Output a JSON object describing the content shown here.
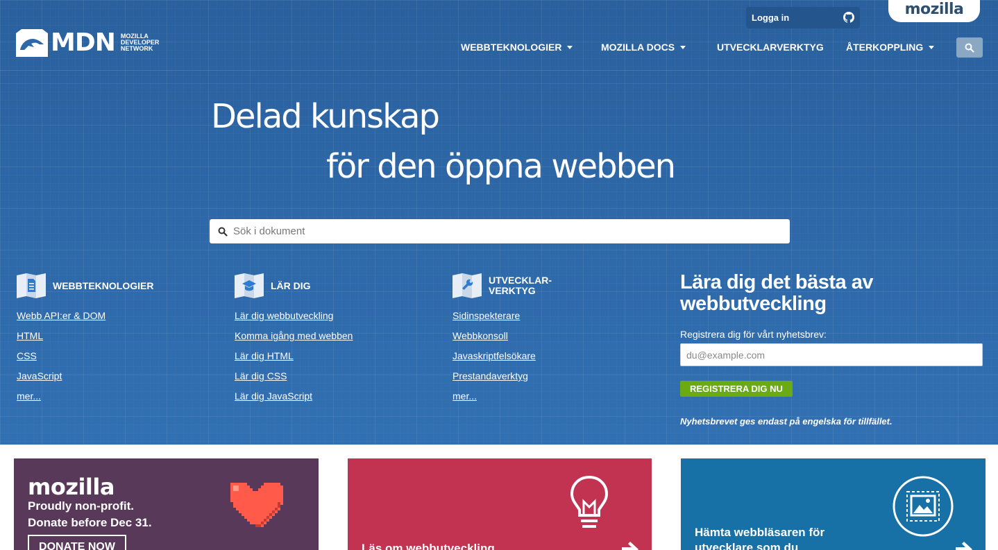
{
  "header": {
    "login_label": "Logga in",
    "mozilla_tab": "mozilla",
    "logo_text": "MDN",
    "logo_sub": [
      "MOZILLA",
      "DEVELOPER",
      "NETWORK"
    ],
    "nav": [
      {
        "label": "WEBBTEKNOLOGIER",
        "has_dropdown": true
      },
      {
        "label": "MOZILLA DOCS",
        "has_dropdown": true
      },
      {
        "label": "UTVECKLARVERKTYG",
        "has_dropdown": false
      },
      {
        "label": "ÅTERKOPPLING",
        "has_dropdown": true
      }
    ]
  },
  "hero": {
    "tagline_1": "Delad kunskap",
    "tagline_2": "för den öppna webben",
    "search_placeholder": "Sök i dokument"
  },
  "columns": [
    {
      "heading": "WEBBTEKNOLOGIER",
      "icon": "document-icon",
      "links": [
        "Webb API:er & DOM",
        "HTML",
        "CSS",
        "JavaScript",
        "mer..."
      ]
    },
    {
      "heading": "LÄR DIG",
      "icon": "graduation-cap-icon",
      "links": [
        "Lär dig webbutveckling",
        "Komma igång med webben",
        "Lär dig HTML",
        "Lär dig CSS",
        "Lär dig JavaScript"
      ]
    },
    {
      "heading_line1": "UTVECKLAR-",
      "heading_line2": "VERKTYG",
      "icon": "wrench-icon",
      "links": [
        "Sidinspekterare",
        "Webbkonsoll",
        "Javaskriptfelsökare",
        "Prestandaverktyg",
        "mer..."
      ]
    }
  ],
  "newsletter": {
    "heading_line1": "Lära dig det bästa av",
    "heading_line2": "webbutveckling",
    "label": "Registrera dig för vårt nyhetsbrev:",
    "email_placeholder": "du@example.com",
    "button": "REGISTRERA DIG NU",
    "note": "Nyhetsbrevet ges endast på engelska för tillfället."
  },
  "promos": [
    {
      "brand": "mozilla",
      "line1": "Proudly non-profit.",
      "line2": "Donate before Dec 31.",
      "button": "DONATE NOW",
      "icon": "heart-icon",
      "color": "#58395a"
    },
    {
      "text": "Läs om webbutveckling",
      "icon": "lightbulb-icon",
      "color": "#c13350"
    },
    {
      "text_line1": "Hämta webbläsaren för",
      "text_line2": "utvecklare som du",
      "icon": "image-frame-icon",
      "color": "#1770a6"
    }
  ],
  "colors": {
    "hero_bg": "#2e68a8",
    "accent_green": "#6aab14"
  }
}
